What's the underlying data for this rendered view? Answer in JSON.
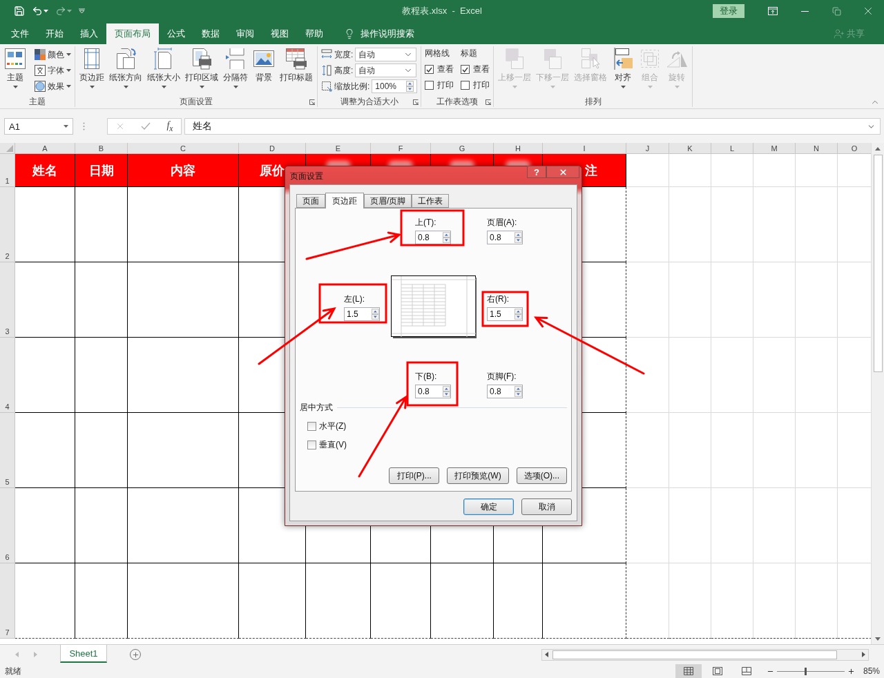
{
  "title_bar": {
    "title": "教程表.xlsx  -  Excel",
    "login": "登录"
  },
  "menu_tabs": [
    {
      "label": "文件",
      "selected": false
    },
    {
      "label": "开始",
      "selected": false
    },
    {
      "label": "插入",
      "selected": false
    },
    {
      "label": "页面布局",
      "selected": true
    },
    {
      "label": "公式",
      "selected": false
    },
    {
      "label": "数据",
      "selected": false
    },
    {
      "label": "审阅",
      "selected": false
    },
    {
      "label": "视图",
      "selected": false
    },
    {
      "label": "帮助",
      "selected": false
    }
  ],
  "tell_me": "操作说明搜索",
  "share": "共享",
  "ribbon": [
    {
      "kind": "theme",
      "label": "主题",
      "launcher": false,
      "large": [
        {
          "label": "主题",
          "caret": true,
          "disabled": false
        }
      ],
      "small": [
        {
          "label": "颜色",
          "caret": true
        },
        {
          "label": "字体",
          "caret": true
        },
        {
          "label": "效果",
          "caret": true
        }
      ]
    },
    {
      "kind": "buttons",
      "label": "页面设置",
      "launcher": true,
      "large": [
        {
          "label": "页边距",
          "caret": true,
          "disabled": false
        },
        {
          "label": "纸张方向",
          "caret": true,
          "disabled": false
        },
        {
          "label": "纸张大小",
          "caret": true,
          "disabled": false
        },
        {
          "label": "打印区域",
          "caret": true,
          "disabled": false
        },
        {
          "label": "分隔符",
          "caret": true,
          "disabled": false
        },
        {
          "label": "背景",
          "caret": false,
          "disabled": false
        },
        {
          "label": "打印标题",
          "caret": false,
          "disabled": false
        }
      ]
    },
    {
      "kind": "scale",
      "label": "调整为合适大小",
      "launcher": true,
      "rows": [
        {
          "kind": "dropdown",
          "label": "宽度:",
          "value": "自动"
        },
        {
          "kind": "dropdown",
          "label": "高度:",
          "value": "自动"
        },
        {
          "kind": "spinner",
          "label": "缩放比例:",
          "value": "100%"
        }
      ]
    },
    {
      "kind": "options",
      "label": "工作表选项",
      "launcher": true,
      "columns": [
        {
          "title": "网格线",
          "checks": [
            {
              "label": "查看",
              "checked": true
            },
            {
              "label": "打印",
              "checked": false
            }
          ]
        },
        {
          "title": "标题",
          "checks": [
            {
              "label": "查看",
              "checked": true
            },
            {
              "label": "打印",
              "checked": false
            }
          ]
        }
      ]
    },
    {
      "kind": "buttons",
      "label": "排列",
      "launcher": false,
      "large": [
        {
          "label": "上移一层",
          "caret": true,
          "disabled": true
        },
        {
          "label": "下移一层",
          "caret": true,
          "disabled": true
        },
        {
          "label": "选择窗格",
          "caret": false,
          "disabled": true
        },
        {
          "label": "对齐",
          "caret": true,
          "disabled": false
        },
        {
          "label": "组合",
          "caret": true,
          "disabled": true
        },
        {
          "label": "旋转",
          "caret": true,
          "disabled": true
        }
      ]
    }
  ],
  "formula_bar": {
    "name_box": "A1",
    "insert_function": "f$_{x}$",
    "value": "姓名"
  },
  "sheet": {
    "columns": [
      "A",
      "B",
      "C",
      "D",
      "E",
      "F",
      "G",
      "H",
      "I",
      "J",
      "K",
      "L",
      "M",
      "N",
      "O"
    ],
    "rows": [
      "1",
      "2",
      "3",
      "4",
      "5",
      "6",
      "7"
    ],
    "header_cells": [
      {
        "kind": "text",
        "text": "姓名"
      },
      {
        "kind": "text",
        "text": "日期"
      },
      {
        "kind": "text",
        "text": "内容"
      },
      {
        "kind": "text",
        "text": "原价"
      },
      {
        "kind": "blurred"
      },
      {
        "kind": "blurred"
      },
      {
        "kind": "blurred"
      },
      {
        "kind": "blurred"
      },
      {
        "kind": "text",
        "text": "注"
      }
    ]
  },
  "dialog": {
    "title": "页面设置",
    "help": "?",
    "tabs": [
      {
        "label": "页面",
        "selected": false
      },
      {
        "label": "页边距",
        "selected": true
      },
      {
        "label": "页眉/页脚",
        "selected": false
      },
      {
        "label": "工作表",
        "selected": false
      }
    ],
    "fields": [
      {
        "kind": "top",
        "label": "上(T):",
        "value": "0.8"
      },
      {
        "kind": "header",
        "label": "页眉(A):",
        "value": "0.8"
      },
      {
        "kind": "left",
        "label": "左(L):",
        "value": "1.5"
      },
      {
        "kind": "right",
        "label": "右(R):",
        "value": "1.5"
      },
      {
        "kind": "bottom",
        "label": "下(B):",
        "value": "0.8"
      },
      {
        "kind": "footer",
        "label": "页脚(F):",
        "value": "0.8"
      }
    ],
    "center_on_page": {
      "title": "居中方式",
      "options": [
        {
          "label": "水平(Z)",
          "checked": false
        },
        {
          "label": "垂直(V)",
          "checked": false
        }
      ]
    },
    "actions": [
      "打印(P)...",
      "打印预览(W)",
      "选项(O)..."
    ],
    "buttons": [
      {
        "label": "确定",
        "default": true
      },
      {
        "label": "取消",
        "default": false
      }
    ]
  },
  "sheet_tabs": [
    {
      "label": "Sheet1",
      "selected": true
    }
  ],
  "status_bar": {
    "text": "就绪",
    "views": [
      {
        "kind": "normal",
        "selected": true
      },
      {
        "kind": "layout",
        "selected": false
      },
      {
        "kind": "break",
        "selected": false
      }
    ],
    "zoom": {
      "level": 0.42,
      "reading": "85%"
    }
  }
}
